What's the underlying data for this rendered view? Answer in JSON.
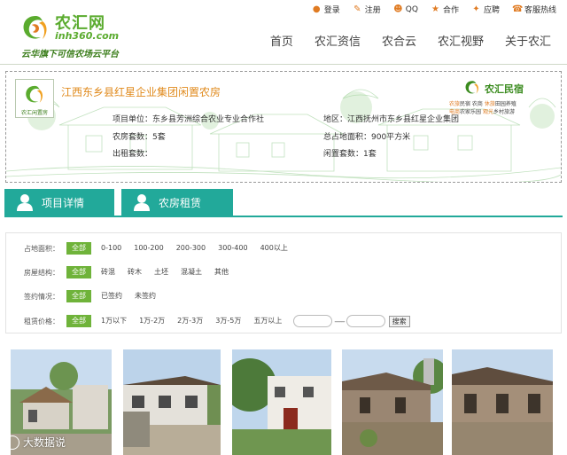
{
  "header": {
    "logo": {
      "brand": "农汇网",
      "domain": "inh360.com",
      "slogan": "云华旗下可信农场云平台"
    },
    "top_links": [
      {
        "icon": "user-icon",
        "label": "登录"
      },
      {
        "icon": "edit-icon",
        "label": "注册"
      },
      {
        "icon": "qq-icon",
        "label": "QQ"
      },
      {
        "icon": "handshake-icon",
        "label": "合作"
      },
      {
        "icon": "share-icon",
        "label": "应聘"
      },
      {
        "icon": "phone-icon",
        "label": "客服热线"
      }
    ],
    "nav": [
      "首页",
      "农汇资信",
      "农合云",
      "农汇视野",
      "关于农汇"
    ]
  },
  "banner": {
    "badge_text": "农汇闲置房",
    "title": "江西东乡县红星企业集团闲置农房",
    "brand": "农汇民宿",
    "tags": {
      "line1a": "农旅",
      "line1b": "民宿 农商",
      "line1c": "休旅",
      "line1d": "田园养殖",
      "line2a": "电商",
      "line2b": "农家乐园",
      "line2c": "观光",
      "line2d": "乡村旅游"
    },
    "project_unit": "项目单位：东乡县芳洲综合农业专业合作社",
    "region": "地区：江西抚州市东乡县红星企业集团",
    "house_count": "农房套数：5套",
    "total_area": "总占地面积：900平方米",
    "rented_count": "出租套数：",
    "idle_count": "闲置套数：1套"
  },
  "tabs": [
    {
      "label": "项目详情"
    },
    {
      "label": "农房租赁"
    }
  ],
  "filters": {
    "area": {
      "label": "占地面积：",
      "active": "全部",
      "options": [
        "0-100",
        "100-200",
        "200-300",
        "300-400",
        "400以上"
      ]
    },
    "structure": {
      "label": "房屋结构：",
      "active": "全部",
      "options": [
        "砖混",
        "砖木",
        "土坯",
        "混凝土",
        "其他"
      ]
    },
    "contract": {
      "label": "签约情况：",
      "active": "全部",
      "options": [
        "已签约",
        "未签约"
      ]
    },
    "price": {
      "label": "租赁价格：",
      "active": "全部",
      "options": [
        "1万以下",
        "1万-2万",
        "2万-3万",
        "3万-5万",
        "五万以上"
      ],
      "dash": "------",
      "search_label": "搜索"
    }
  },
  "watermark": "大数据说",
  "colors": {
    "accent": "#22a99a",
    "green": "#6fb33a",
    "orange": "#e08a1c"
  }
}
